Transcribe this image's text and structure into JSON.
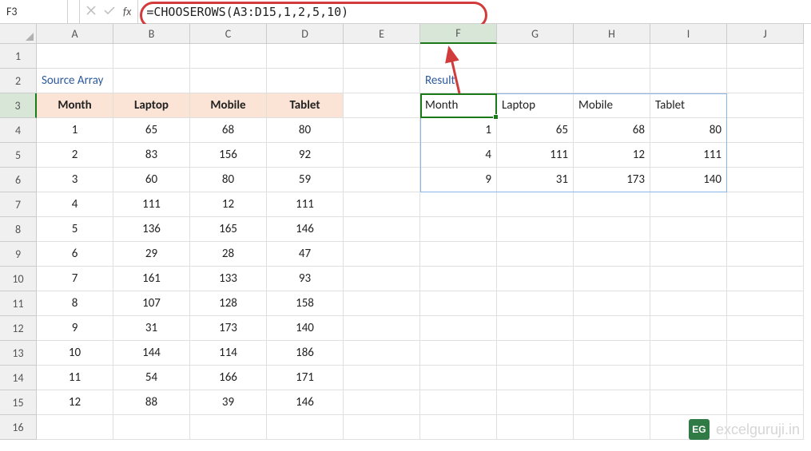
{
  "name_box": "F3",
  "formula": "=CHOOSEROWS(A3:D15,1,2,5,10)",
  "col_letters": [
    "A",
    "B",
    "C",
    "D",
    "E",
    "F",
    "G",
    "H",
    "I",
    "J"
  ],
  "row_numbers": [
    "1",
    "2",
    "3",
    "4",
    "5",
    "6",
    "7",
    "8",
    "9",
    "10",
    "11",
    "12",
    "13",
    "14",
    "15",
    "16"
  ],
  "source_label": "Source Array",
  "result_label": "Result",
  "chart_data": {
    "type": "table",
    "title": "Source Array",
    "columns": [
      "Month",
      "Laptop",
      "Mobile",
      "Tablet"
    ],
    "rows": [
      [
        "1",
        "65",
        "68",
        "80"
      ],
      [
        "2",
        "83",
        "156",
        "92"
      ],
      [
        "3",
        "60",
        "80",
        "59"
      ],
      [
        "4",
        "111",
        "12",
        "111"
      ],
      [
        "5",
        "136",
        "165",
        "146"
      ],
      [
        "6",
        "29",
        "28",
        "47"
      ],
      [
        "7",
        "161",
        "133",
        "93"
      ],
      [
        "8",
        "107",
        "128",
        "158"
      ],
      [
        "9",
        "31",
        "173",
        "140"
      ],
      [
        "10",
        "144",
        "114",
        "186"
      ],
      [
        "11",
        "54",
        "166",
        "171"
      ],
      [
        "12",
        "88",
        "39",
        "146"
      ]
    ],
    "result_columns": [
      "Month",
      "Laptop",
      "Mobile",
      "Tablet"
    ],
    "result_rows": [
      [
        "1",
        "65",
        "68",
        "80"
      ],
      [
        "4",
        "111",
        "12",
        "111"
      ],
      [
        "9",
        "31",
        "173",
        "140"
      ]
    ]
  },
  "watermark": {
    "logo": "EG",
    "text": "excelguruji.in"
  }
}
